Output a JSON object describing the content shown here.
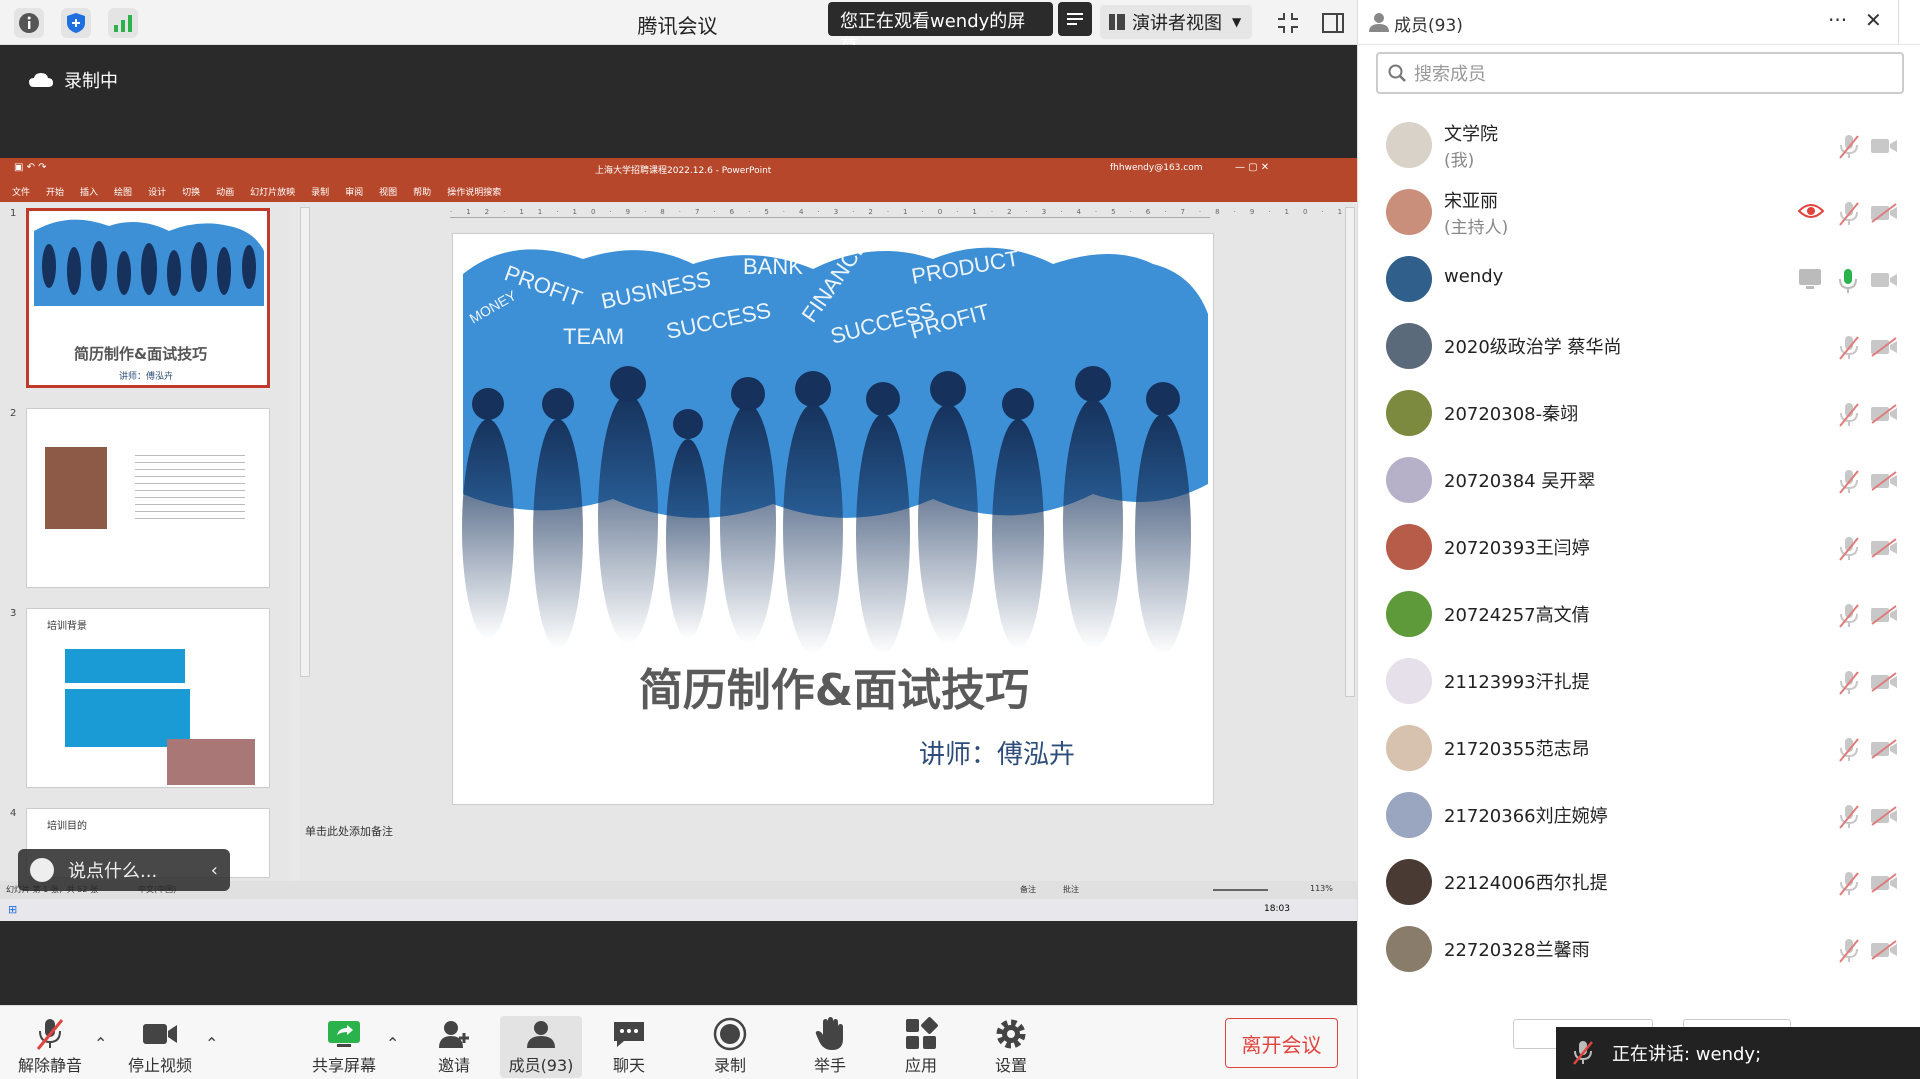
{
  "topbar": {
    "app_title": "腾讯会议",
    "viewing_text": "您正在观看wendy的屏幕",
    "presenter_view": "演讲者视图"
  },
  "stage": {
    "recording": "录制中",
    "chat_placeholder": "说点什么..."
  },
  "ppt": {
    "title": "上海大学招聘课程2022.12.6 - PowerPoint",
    "user": "fhhwendy@163.com",
    "tabs": [
      "文件",
      "开始",
      "插入",
      "绘图",
      "设计",
      "切换",
      "动画",
      "幻灯片放映",
      "录制",
      "审阅",
      "视图",
      "帮助",
      "操作说明搜索"
    ],
    "slide_title": "简历制作&面试技巧",
    "slide_speaker": "讲师：傅泓卉",
    "thumb1_title": "简历制作&面试技巧",
    "thumb1_sub": "讲师：傅泓卉",
    "thumb3_title": "培训背景",
    "thumb4_title": "培训目的",
    "thumb_numbers": [
      "1",
      "2",
      "3",
      "4"
    ],
    "notes": "单击此处添加备注",
    "zoom": "113%",
    "clock": "18:03",
    "status_left": "幻灯片 第 1 张，共 52 张",
    "status_lang": "中文(中国)",
    "status_notes": "备注",
    "status_comments": "批注"
  },
  "toolbar": {
    "unmute": "解除静音",
    "stop_video": "停止视频",
    "share": "共享屏幕",
    "invite": "邀请",
    "members": "成员(93)",
    "chat": "聊天",
    "record": "录制",
    "raise_hand": "举手",
    "apps": "应用",
    "settings": "设置",
    "leave": "离开会议"
  },
  "panel": {
    "title": "成员(93)",
    "search_placeholder": "搜索成员",
    "speaking": "正在讲话: wendy;",
    "members": [
      {
        "name": "文学院",
        "role": "(我)"
      },
      {
        "name": "宋亚丽",
        "role": "(主持人)"
      },
      {
        "name": "wendy",
        "role": ""
      },
      {
        "name": "2020级政治学 蔡华尚",
        "role": ""
      },
      {
        "name": "20720308-秦翊",
        "role": ""
      },
      {
        "name": "20720384 吴开翠",
        "role": ""
      },
      {
        "name": "20720393王闫婷",
        "role": ""
      },
      {
        "name": "20724257高文倩",
        "role": ""
      },
      {
        "name": "21123993汗扎提",
        "role": ""
      },
      {
        "name": "21720355范志昂",
        "role": ""
      },
      {
        "name": "21720366刘庄婉婷",
        "role": ""
      },
      {
        "name": "22124006西尔扎提",
        "role": ""
      },
      {
        "name": "22720328兰馨雨",
        "role": ""
      }
    ]
  },
  "colors": {
    "ppt_red": "#b7472a",
    "leave_red": "#e0443e",
    "slide_blue": "#2e7ec6",
    "silhouette": "#16325c"
  }
}
